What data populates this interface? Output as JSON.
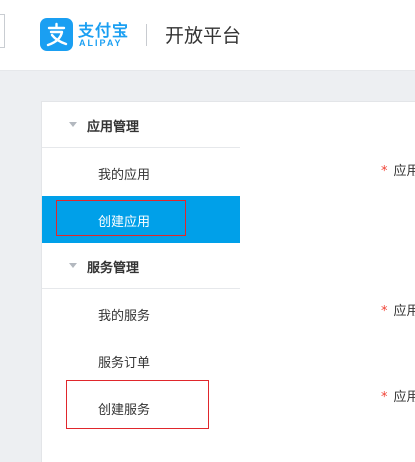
{
  "header": {
    "logo_cn": "支付宝",
    "logo_en": "ALIPAY",
    "title": "开放平台"
  },
  "sidebar": {
    "groups": [
      {
        "label": "应用管理",
        "items": [
          {
            "label": "我的应用"
          },
          {
            "label": "创建应用",
            "active": true
          }
        ]
      },
      {
        "label": "服务管理",
        "items": [
          {
            "label": "我的服务"
          },
          {
            "label": "服务订单"
          },
          {
            "label": "创建服务"
          }
        ]
      }
    ]
  },
  "main": {
    "fields": [
      {
        "required_mark": "*",
        "label": "应用"
      },
      {
        "required_mark": "*",
        "label": "应用"
      },
      {
        "required_mark": "*",
        "label": "应用"
      }
    ]
  },
  "colors": {
    "brand_blue": "#1a9ff2",
    "active_bg": "#00a0e9",
    "highlight_red": "#e0272c",
    "required_red": "#f04134"
  }
}
